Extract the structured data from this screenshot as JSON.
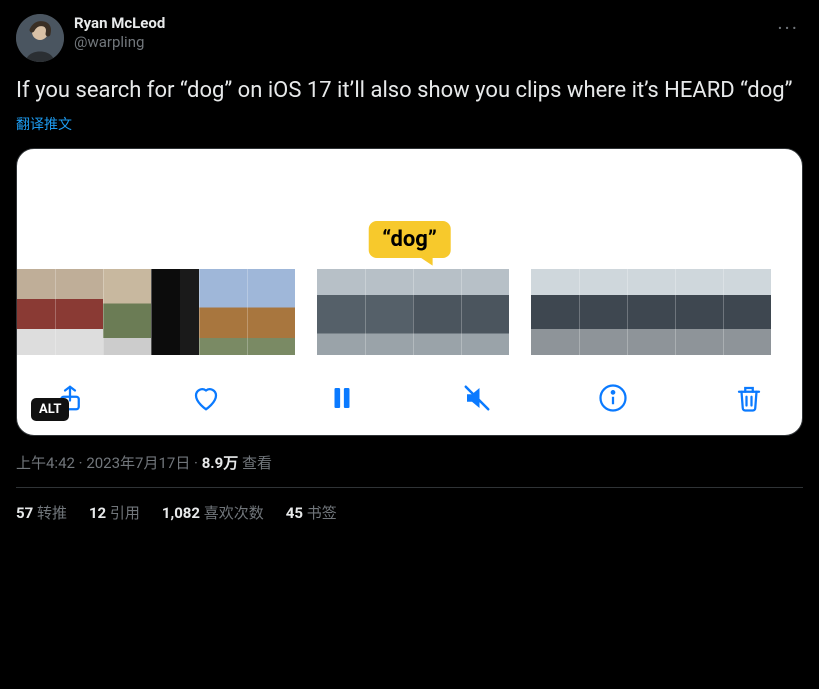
{
  "author": {
    "display_name": "Ryan McLeod",
    "handle": "@warpling"
  },
  "tweet_text": "If you search for “dog” on iOS 17 it’ll also show you clips where it’s HEARD “dog”",
  "translate_label": "翻译推文",
  "bubble_text": "“dog”",
  "alt_badge": "ALT",
  "timestamp": {
    "time": "上午4:42",
    "dot": " · ",
    "date": "2023年7月17日",
    "views_count": "8.9万",
    "views_label": " 查看"
  },
  "stats": {
    "retweets_count": "57",
    "retweets_label": " 转推",
    "quotes_count": "12",
    "quotes_label": " 引用",
    "likes_count": "1,082",
    "likes_label": " 喜欢次数",
    "bookmarks_count": "45",
    "bookmarks_label": " 书签"
  }
}
